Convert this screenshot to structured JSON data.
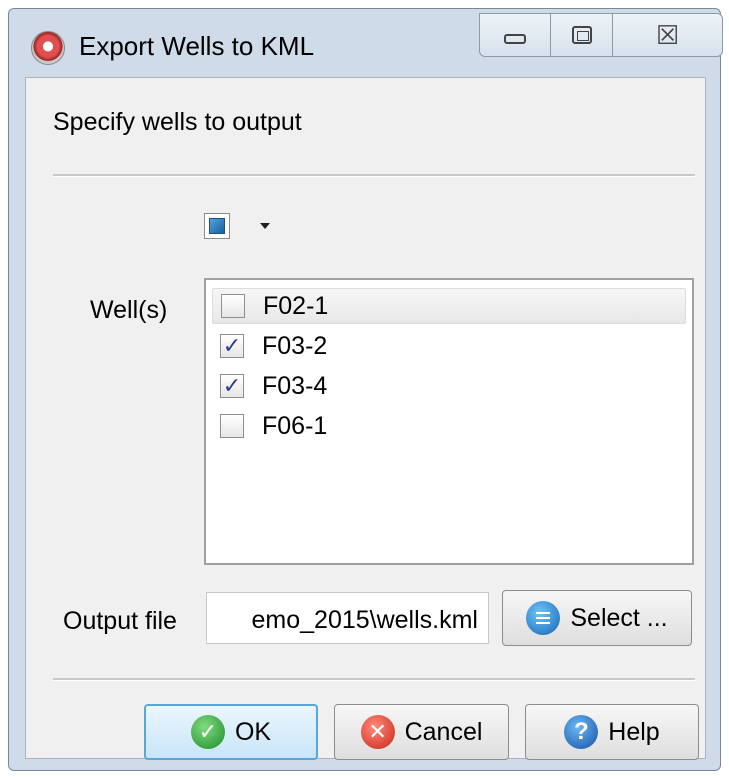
{
  "window": {
    "title": "Export Wells to KML",
    "icons": {
      "app": "app-logo-icon",
      "minimize": "minimize-icon",
      "maximize": "maximize-icon",
      "close": "close-icon"
    }
  },
  "header": {
    "text": "Specify wells to output"
  },
  "selector": {
    "icon": "select-all-checkbox-icon",
    "arrow": "chevron-down-icon"
  },
  "wells": {
    "label": "Well(s)",
    "items": [
      {
        "label": "F02-1",
        "checked": false
      },
      {
        "label": "F03-2",
        "checked": true
      },
      {
        "label": "F03-4",
        "checked": true
      },
      {
        "label": "F06-1",
        "checked": false
      }
    ],
    "check_glyph": "✓"
  },
  "output": {
    "label": "Output file",
    "value": "emo_2015\\wells.kml",
    "select_label": "Select ..."
  },
  "buttons": {
    "ok": "OK",
    "cancel": "Cancel",
    "help": "Help",
    "help_glyph": "?",
    "cancel_glyph": "✕",
    "ok_glyph": "✓",
    "close_glyph": "☒"
  }
}
